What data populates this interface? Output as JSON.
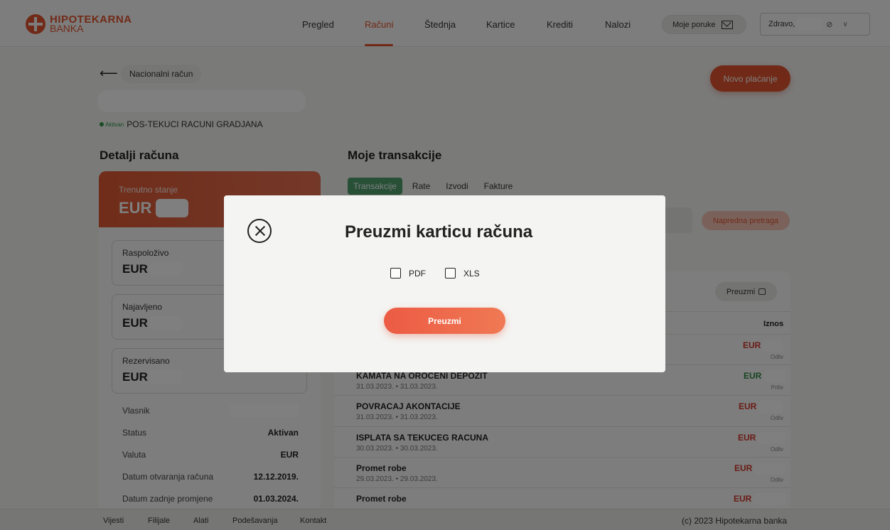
{
  "brand": {
    "line1": "HIPOTEKARNA",
    "line2": "BANKA"
  },
  "nav": {
    "items": [
      {
        "label": "Pregled"
      },
      {
        "label": "Računi"
      },
      {
        "label": "Štednja"
      },
      {
        "label": "Kartice"
      },
      {
        "label": "Krediti"
      },
      {
        "label": "Nalozi"
      }
    ],
    "active": "Računi",
    "messages_label": "Moje poruke",
    "greeting": "Zdravo,"
  },
  "account": {
    "breadcrumb": "Nacionalni račun",
    "status_small": "Aktivan",
    "type": "POS-TEKUCI RACUNI GRADJANA",
    "new_payment": "Novo plaćanje"
  },
  "details": {
    "title": "Detalji računa",
    "current_balance_label": "Trenutno stanje",
    "currency": "EUR",
    "cards": [
      {
        "label": "Raspoloživo",
        "currency": "EUR"
      },
      {
        "label": "Najavljeno",
        "currency": "EUR"
      },
      {
        "label": "Rezervisano",
        "currency": "EUR"
      }
    ],
    "rows": [
      {
        "label": "Vlasnik",
        "value": ""
      },
      {
        "label": "Status",
        "value": "Aktivan"
      },
      {
        "label": "Valuta",
        "value": "EUR"
      },
      {
        "label": "Datum otvaranja računa",
        "value": "12.12.2019."
      },
      {
        "label": "Datum zadnje promjene",
        "value": "01.03.2024."
      }
    ]
  },
  "transactions": {
    "title": "Moje transakcije",
    "tabs": [
      "Transakcije",
      "Rate",
      "Izvodi",
      "Fakture"
    ],
    "advanced_search": "Napredna pretraga",
    "download_label": "Preuzmi",
    "amount_header": "Iznos",
    "rows": [
      {
        "name": "",
        "date": "",
        "currency": "EUR",
        "direction": "Odliv",
        "type": "out"
      },
      {
        "name": "KAMATA NA OROCENI DEPOZIT",
        "date": "31.03.2023. • 31.03.2023.",
        "currency": "EUR",
        "direction": "Priliv",
        "type": "in"
      },
      {
        "name": "POVRACAJ AKONTACIJE",
        "date": "31.03.2023. • 31.03.2023.",
        "currency": "EUR",
        "direction": "Odliv",
        "type": "out"
      },
      {
        "name": "ISPLATA SA TEKUCEG RACUNA",
        "date": "30.03.2023. • 30.03.2023.",
        "currency": "EUR",
        "direction": "Odliv",
        "type": "out"
      },
      {
        "name": "Promet robe",
        "date": "29.03.2023. • 29.03.2023.",
        "currency": "EUR",
        "direction": "Odliv",
        "type": "out"
      },
      {
        "name": "Promet robe",
        "date": "",
        "currency": "EUR",
        "direction": "",
        "type": "out"
      }
    ]
  },
  "footer": {
    "links": [
      "Vijesti",
      "Filijale",
      "Alati",
      "Podešavanja",
      "Kontakt"
    ],
    "copyright": "(c) 2023 Hipotekarna banka"
  },
  "modal": {
    "title": "Preuzmi karticu računa",
    "options": [
      {
        "label": "PDF",
        "checked": false
      },
      {
        "label": "XLS",
        "checked": false
      }
    ],
    "button": "Preuzmi"
  },
  "colors": {
    "accent": "#e2552f",
    "tab_active": "#4ea06e",
    "positive": "#2e8a45",
    "negative": "#d2392a"
  }
}
